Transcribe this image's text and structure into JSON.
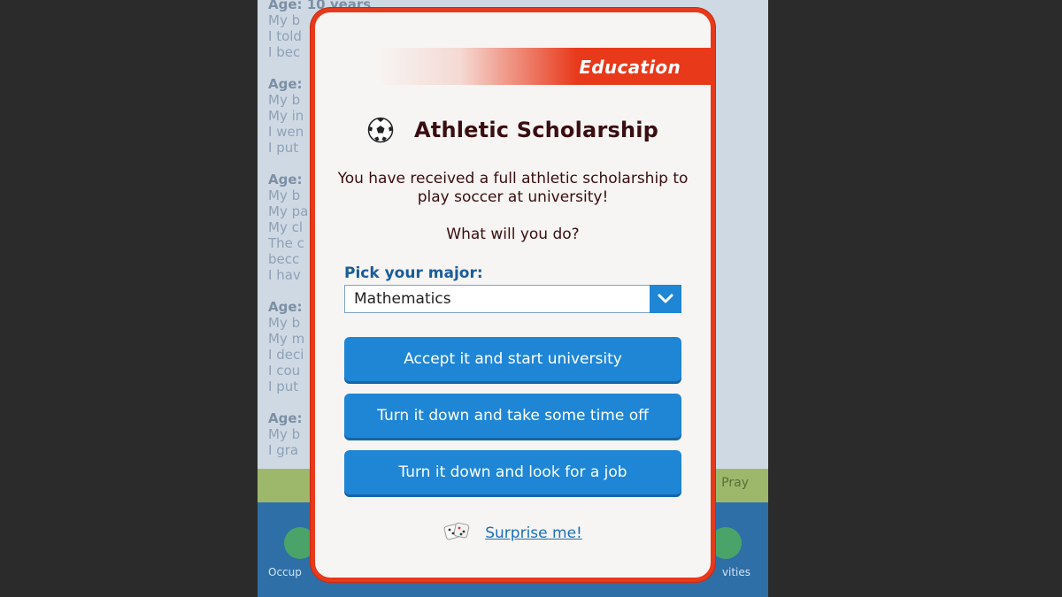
{
  "background": {
    "log": [
      {
        "age": "Age: 10 years",
        "lines": [
          "My b",
          "I told",
          "I bec"
        ]
      },
      {
        "age": "Age:",
        "lines": [
          "My b",
          "My in",
          "I wen",
          "I put"
        ]
      },
      {
        "age": "Age:",
        "lines": [
          "My b",
          "My pa",
          "My cl",
          "The c",
          "becc",
          "I hav"
        ]
      },
      {
        "age": "Age:",
        "lines": [
          "My b",
          "My m",
          "I deci",
          "I cou",
          "I put"
        ]
      },
      {
        "age": "Age:",
        "lines": [
          "My b",
          "I gra"
        ]
      }
    ],
    "strip_right_text": "Pray",
    "tab_left": "Occup",
    "tab_right": "vities"
  },
  "modal": {
    "banner": "Education",
    "icon": "soccer-ball-icon",
    "title": "Athletic Scholarship",
    "description": "You have received a full athletic scholarship to play soccer at university!",
    "question": "What will you do?",
    "pick_label": "Pick your major:",
    "major_selected": "Mathematics",
    "buttons": [
      "Accept it and start university",
      "Turn it down and take some time off",
      "Turn it down and look for a job"
    ],
    "surprise_icon": "dice-icon",
    "surprise_label": "Surprise me!"
  },
  "colors": {
    "accent_red": "#e8391b",
    "button_blue": "#1f86d6",
    "title_text": "#3a0d10",
    "label_blue": "#1a5c9a"
  }
}
